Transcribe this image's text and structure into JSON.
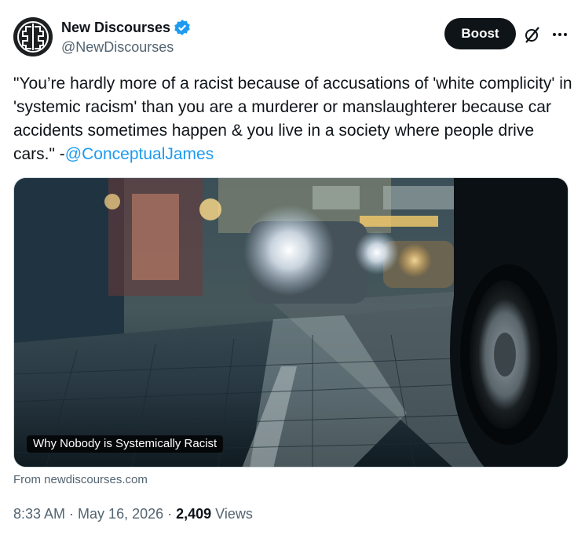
{
  "author": {
    "display_name": "New Discourses",
    "handle": "@NewDiscourses",
    "verified_icon": "verified-badge-icon",
    "avatar_icon": "brain-logo-icon"
  },
  "actions": {
    "boost_label": "Boost",
    "grok_icon": "grok-icon",
    "more_icon": "more-icon"
  },
  "tweet": {
    "text_before": "\"You’re hardly more of a racist because of accusations of 'white complicity' in 'systemic racism' than you are a murderer or manslaughterer because car accidents sometimes happen & you live in a society where people drive cars.\" -",
    "mention": "@ConceptualJames"
  },
  "card": {
    "title": "Why Nobody is Systemically Racist",
    "from_prefix": "From ",
    "domain": "newdiscourses.com"
  },
  "meta": {
    "time": "8:33 AM",
    "separator": " · ",
    "date": "May 16, 2026",
    "views_count": "2,409",
    "views_label": " Views"
  },
  "colors": {
    "accent": "#1d9bf0",
    "text": "#0f1419",
    "secondary": "#536471"
  }
}
